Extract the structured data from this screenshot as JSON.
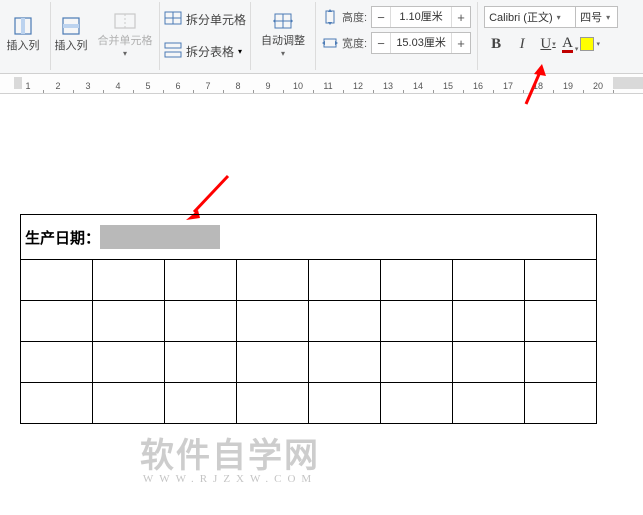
{
  "ribbon": {
    "insert_col_label": "插入列",
    "insert_row_label": "插入列",
    "merge_cells_label": "合并单元格",
    "split_cells_label": "拆分单元格",
    "split_table_label": "拆分表格",
    "auto_fit_label": "自动调整",
    "height_label": "高度:",
    "width_label": "宽度:",
    "height_value": "1.10厘米",
    "width_value": "15.03厘米",
    "font_name": "Calibri (正文)",
    "font_size": "四号",
    "bold_glyph": "B",
    "italic_glyph": "I",
    "underline_glyph": "U",
    "color_glyph": "A"
  },
  "ruler": {
    "marks": [
      "1",
      "2",
      "3",
      "4",
      "5",
      "6",
      "7",
      "8",
      "9",
      "10",
      "11",
      "12",
      "13",
      "14",
      "15",
      "16",
      "17",
      "18",
      "19",
      "20"
    ]
  },
  "document": {
    "header_text": "生产日期："
  },
  "watermark": {
    "main": "软件自学网",
    "sub": "WWW.RJZXW.COM"
  }
}
